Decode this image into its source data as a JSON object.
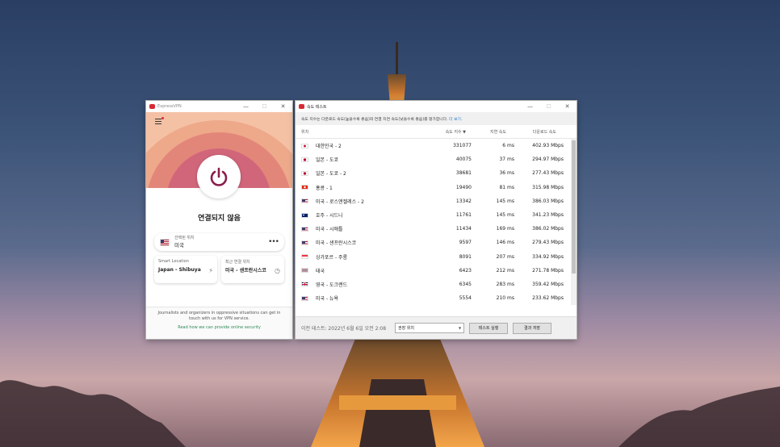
{
  "vpn": {
    "title": "ExpressVPN",
    "status": "연결되지 않음",
    "selected_location_label": "선택된 위치",
    "selected_location_value": "미국",
    "smart_location_label": "Smart Location",
    "smart_location_value": "Japan - Shibuya",
    "recent_location_label": "최근 연결 위치",
    "recent_location_value": "미국 - 샌프란시스코",
    "footer_text": "Journalists and organizers in oppressive situations can get in touch with us for VPN service.",
    "footer_link": "Read how we can provide online security",
    "controls": {
      "minimize": "—",
      "maximize": "☐",
      "close": "✕"
    }
  },
  "speedtest": {
    "title": "속도 테스트",
    "description": "속도 지수는 다운로드 속도(높을수록 좋음)와 연결 지연 속도(낮을수록 좋음)를 평가합니다.",
    "description_link": "더 보기.",
    "columns": {
      "location": "위치",
      "speed_index": "속도 지수 ▼",
      "latency": "지연 속도",
      "download": "다운로드 속도"
    },
    "rows": [
      {
        "flag": "kr",
        "name": "대한민국 - 2",
        "speed": "331077",
        "latency": "6 ms",
        "download": "402.93 Mbps"
      },
      {
        "flag": "jp",
        "name": "일본 - 도쿄",
        "speed": "40075",
        "latency": "37 ms",
        "download": "294.97 Mbps"
      },
      {
        "flag": "jp",
        "name": "일본 - 도쿄 - 2",
        "speed": "38681",
        "latency": "36 ms",
        "download": "277.43 Mbps"
      },
      {
        "flag": "hk",
        "name": "홍콩 - 1",
        "speed": "19490",
        "latency": "81 ms",
        "download": "315.98 Mbps"
      },
      {
        "flag": "us",
        "name": "미국 - 로스앤젤레스 - 2",
        "speed": "13342",
        "latency": "145 ms",
        "download": "386.03 Mbps"
      },
      {
        "flag": "au",
        "name": "호주 - 시드니",
        "speed": "11761",
        "latency": "145 ms",
        "download": "341.23 Mbps"
      },
      {
        "flag": "us",
        "name": "미국 - 시애틀",
        "speed": "11434",
        "latency": "169 ms",
        "download": "386.02 Mbps"
      },
      {
        "flag": "us",
        "name": "미국 - 샌프란시스코",
        "speed": "9597",
        "latency": "146 ms",
        "download": "279.43 Mbps"
      },
      {
        "flag": "sg",
        "name": "싱가포르 - 주롱",
        "speed": "8091",
        "latency": "207 ms",
        "download": "334.92 Mbps"
      },
      {
        "flag": "th",
        "name": "태국",
        "speed": "6423",
        "latency": "212 ms",
        "download": "271.78 Mbps"
      },
      {
        "flag": "gb",
        "name": "영국 - 도크랜드",
        "speed": "6345",
        "latency": "283 ms",
        "download": "359.42 Mbps"
      },
      {
        "flag": "us",
        "name": "미국 - 뉴욕",
        "speed": "5554",
        "latency": "210 ms",
        "download": "233.62 Mbps"
      }
    ],
    "last_test": "이전 테스트: 2022년 6월 6일 오전 2:08",
    "region_select": "권장 위치",
    "run_button": "테스트 실행",
    "save_button": "결과 저장",
    "controls": {
      "minimize": "—",
      "maximize": "☐",
      "close": "✕"
    }
  }
}
